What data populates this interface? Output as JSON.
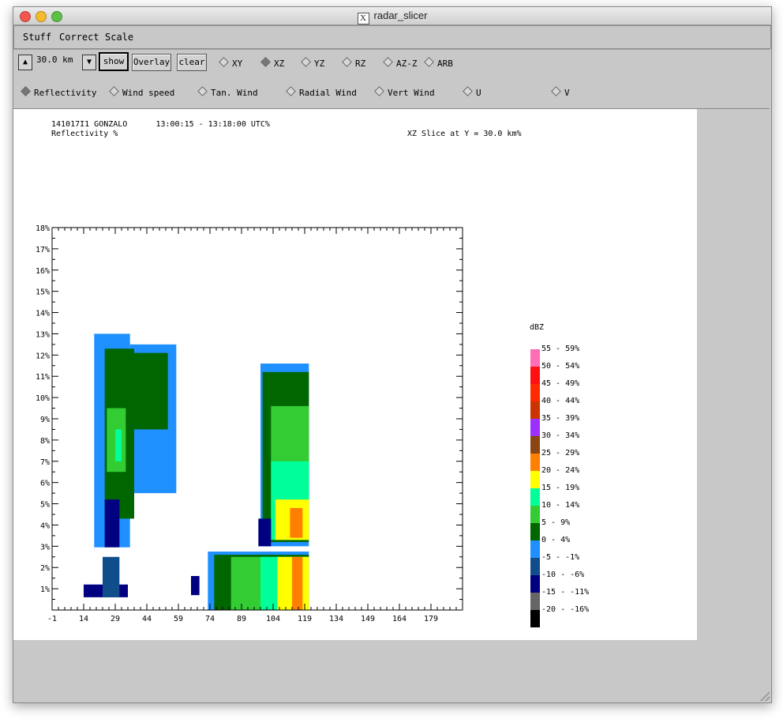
{
  "window": {
    "title": "radar_slicer"
  },
  "menu": [
    "Stuff",
    "Correct",
    "Scale"
  ],
  "controls": {
    "height_value": "30.0 km",
    "up_icon": "up-triangle-icon",
    "down_icon": "down-triangle-icon",
    "show_label": "show",
    "overlay_label": "Overlay",
    "clear_label": "clear",
    "slice_types": [
      "XY",
      "XZ",
      "YZ",
      "RZ",
      "AZ-Z",
      "ARB"
    ],
    "selected_slice": "XZ",
    "fields": [
      "Reflectivity",
      "Wind speed",
      "Tan. Wind",
      "Radial Wind",
      "Vert Wind",
      "U",
      "V"
    ],
    "selected_field": "Reflectivity"
  },
  "plot": {
    "header_line1": "141017I1 GONZALO      13:00:15 - 13:18:00 UTC%",
    "header_line2": "Reflectivity %",
    "slice_label": "XZ Slice at Y = 30.0 km%",
    "legend_title": "dBZ",
    "legend": [
      {
        "label": "55 - 59%",
        "color": "#ff6eb4"
      },
      {
        "label": "50 - 54%",
        "color": "#ff1010"
      },
      {
        "label": "45 - 49%",
        "color": "#ff2a00"
      },
      {
        "label": "40 - 44%",
        "color": "#cc3300"
      },
      {
        "label": "35 - 39%",
        "color": "#9b30ff"
      },
      {
        "label": "30 - 34%",
        "color": "#8b4513"
      },
      {
        "label": "25 - 29%",
        "color": "#ff8000"
      },
      {
        "label": "20 - 24%",
        "color": "#ffff00"
      },
      {
        "label": "15 - 19%",
        "color": "#00ff99"
      },
      {
        "label": "10 - 14%",
        "color": "#33cc33"
      },
      {
        "label": "5 - 9%",
        "color": "#006600"
      },
      {
        "label": "0 - 4%",
        "color": "#1e90ff"
      },
      {
        "label": "-5 - -1%",
        "color": "#104e8b"
      },
      {
        "label": "-10 - -6%",
        "color": "#000080"
      },
      {
        "label": "-15 - -11%",
        "color": "#666666"
      },
      {
        "label": "-20 - -16%",
        "color": "#000000"
      }
    ]
  },
  "chart_data": {
    "type": "heatmap",
    "x_ticks": [
      "-1",
      "14",
      "29",
      "44",
      "59",
      "74",
      "89",
      "104",
      "119",
      "134",
      "149",
      "164",
      "179"
    ],
    "y_ticks": [
      "1%",
      "2%",
      "3%",
      "4%",
      "5%",
      "6%",
      "7%",
      "8%",
      "9%",
      "10%",
      "11%",
      "12%",
      "13%",
      "14%",
      "15%",
      "16%",
      "17%",
      "18%"
    ],
    "xlim": [
      -1,
      194
    ],
    "ylim": [
      0,
      18
    ],
    "color_variable": "dBZ",
    "regions": [
      {
        "x": [
          19,
          36
        ],
        "y": [
          2.8,
          13
        ],
        "dbz": 0
      },
      {
        "x": [
          36,
          58
        ],
        "y": [
          5.5,
          12.5
        ],
        "dbz": 0
      },
      {
        "x": [
          24,
          38
        ],
        "y": [
          4.3,
          12.3
        ],
        "dbz": 5
      },
      {
        "x": [
          37,
          54
        ],
        "y": [
          8.5,
          12.1
        ],
        "dbz": 5
      },
      {
        "x": [
          25,
          34
        ],
        "y": [
          6.5,
          9.5
        ],
        "dbz": 10
      },
      {
        "x": [
          29,
          32
        ],
        "y": [
          7,
          8.5
        ],
        "dbz": 15
      },
      {
        "x": [
          24,
          31
        ],
        "y": [
          2.8,
          5.2
        ],
        "dbz": -10
      },
      {
        "x": [
          14,
          35
        ],
        "y": [
          0.6,
          1.2
        ],
        "dbz": -10
      },
      {
        "x": [
          23,
          31
        ],
        "y": [
          0.6,
          2.5
        ],
        "dbz": -5
      },
      {
        "x": [
          98,
          121
        ],
        "y": [
          3,
          11.6
        ],
        "dbz": 0
      },
      {
        "x": [
          99,
          121
        ],
        "y": [
          3.2,
          11.2
        ],
        "dbz": 5
      },
      {
        "x": [
          103,
          121
        ],
        "y": [
          3.3,
          9.6
        ],
        "dbz": 10
      },
      {
        "x": [
          103,
          121
        ],
        "y": [
          3.3,
          7
        ],
        "dbz": 15
      },
      {
        "x": [
          105,
          121
        ],
        "y": [
          3.3,
          5.2
        ],
        "dbz": 20
      },
      {
        "x": [
          112,
          118
        ],
        "y": [
          3.4,
          4.8
        ],
        "dbz": 25
      },
      {
        "x": [
          97,
          103
        ],
        "y": [
          3,
          4.3
        ],
        "dbz": -10
      },
      {
        "x": [
          73,
          121
        ],
        "y": [
          0,
          2.8
        ],
        "dbz": 0
      },
      {
        "x": [
          76,
          121
        ],
        "y": [
          0,
          2.6
        ],
        "dbz": 5
      },
      {
        "x": [
          84,
          121
        ],
        "y": [
          0,
          2.5
        ],
        "dbz": 10
      },
      {
        "x": [
          98,
          121
        ],
        "y": [
          0,
          2.5
        ],
        "dbz": 15
      },
      {
        "x": [
          106,
          121
        ],
        "y": [
          0,
          2.5
        ],
        "dbz": 20
      },
      {
        "x": [
          113,
          118
        ],
        "y": [
          0,
          2.5
        ],
        "dbz": 25
      },
      {
        "x": [
          65,
          69
        ],
        "y": [
          0.7,
          1.6
        ],
        "dbz": -10
      }
    ]
  }
}
